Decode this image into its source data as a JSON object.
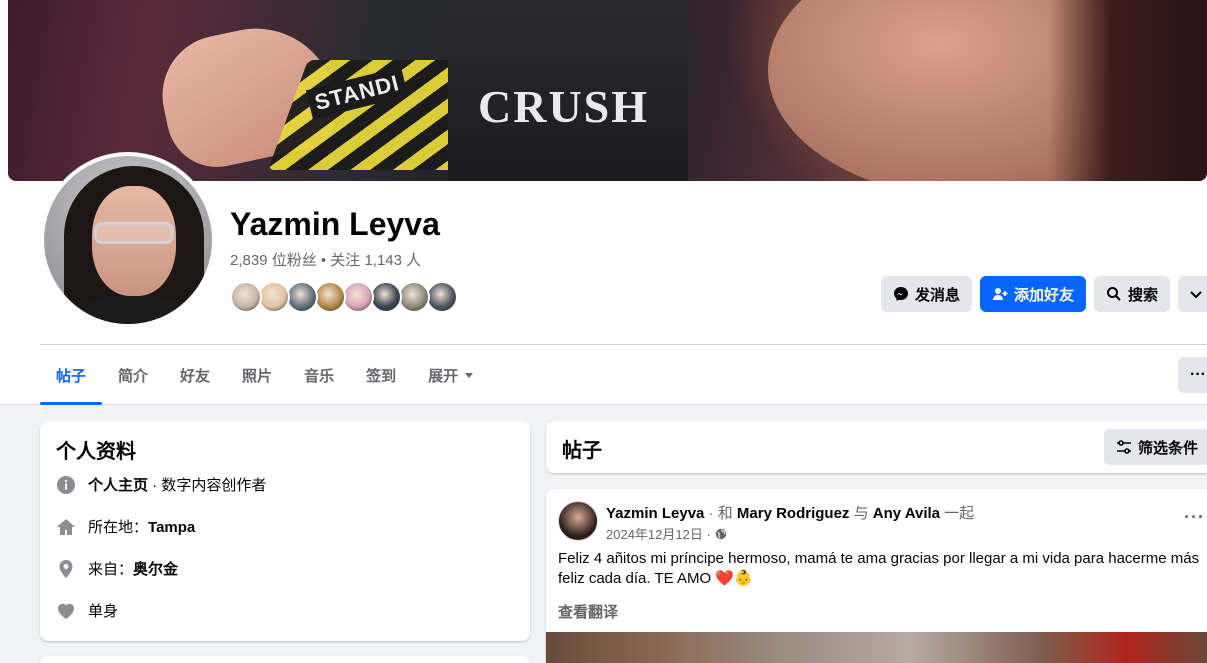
{
  "cover": {
    "text": "STANDI",
    "shirt_text": "CRUSH"
  },
  "profile": {
    "name": "Yazmin Leyva",
    "followers_line": "2,839 位粉丝 • 关注 1,143 人"
  },
  "friend_colors": [
    "#c7b6a5",
    "#e2c3a0",
    "#5f7080",
    "#b6884a",
    "#d9a4b8",
    "#3b4452",
    "#8f8a7a",
    "#4d5560"
  ],
  "actions": {
    "message_label": "发消息",
    "add_friend_label": "添加好友",
    "search_label": "搜索"
  },
  "tabs": [
    "帖子",
    "简介",
    "好友",
    "照片",
    "音乐",
    "签到",
    "展开"
  ],
  "tab_more_label": "···",
  "intro": {
    "title": "个人资料",
    "page_label": "个人主页",
    "page_sep": " · ",
    "page_category": "数字内容创作者",
    "location_prefix": "所在地：",
    "location": "Tampa",
    "from_prefix": "来自：",
    "from": "奥尔金",
    "relationship": "单身"
  },
  "posts": {
    "title": "帖子",
    "filter_label": "筛选条件"
  },
  "post": {
    "author": "Yazmin Leyva",
    "with_word": " · 和 ",
    "tag1": "Mary Rodriguez",
    "and_word": " 与 ",
    "tag2": "Any Avila",
    "together_word": " 一起",
    "date": "2024年12月12日 ·",
    "text_line1": "Feliz 4 añitos mi príncipe hermoso, mamá te ama gracias por llegar a mi vida para hacerme más",
    "text_line2": "feliz cada día.  TE AMO ❤️👶",
    "see_translation": "查看翻译",
    "more": "···"
  }
}
